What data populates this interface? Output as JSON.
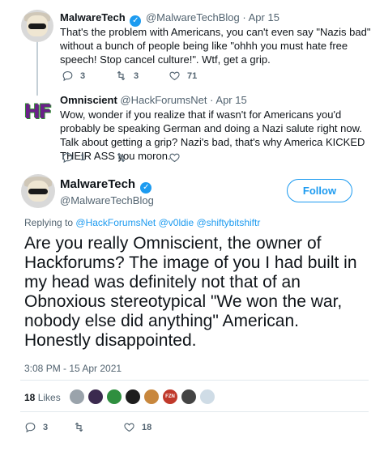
{
  "tweets": [
    {
      "name": "MalwareTech",
      "verified": true,
      "handle": "@MalwareTechBlog",
      "date": "Apr 15",
      "text": "That's the problem with Americans, you can't even say \"Nazis bad\" without a bunch of people being like \"ohhh you must hate free speech! Stop cancel culture!\". Wtf, get a grip.",
      "replies": "3",
      "retweets": "3",
      "likes": "71"
    },
    {
      "name": "Omniscient",
      "verified": false,
      "handle": "@HackForumsNet",
      "date": "Apr 15",
      "text": "Wow, wonder if you realize that if wasn't for Americans you'd probably be speaking German and doing a Nazi salute right now.   Talk about getting a grip? Nazi's bad, that's why America KICKED THEIR ASS you moron.",
      "replies": "1",
      "retweets": "",
      "likes": ""
    }
  ],
  "main_tweet": {
    "name": "MalwareTech",
    "handle": "@MalwareTechBlog",
    "follow_label": "Follow",
    "replying_prefix": "Replying to",
    "replying_mentions": "@HackForumsNet @v0ldie @shiftybitshiftr",
    "text": "Are you really Omniscient, the owner of Hackforums? The image of you I had built in my head was definitely not that of an Obnoxious stereotypical \"We won the war, nobody else did anything\" American. Honestly disappointed.",
    "timestamp": "3:08 PM - 15 Apr 2021",
    "likes_count": "18",
    "likes_label": "Likes",
    "replies": "3",
    "retweets": "",
    "likes": "18"
  },
  "dot": "·",
  "verified_glyph": "✓",
  "colors": {
    "accent": "#1d9bf0",
    "text": "#0f1419",
    "muted": "#536471"
  },
  "liker_avatars": [
    "#9aa3ab",
    "#3b2a4f",
    "#2f8f3f",
    "#1d1d1d",
    "#c8873d",
    "#c0392b",
    "#444444",
    "#cfdce6"
  ],
  "liker_badge": "FZN"
}
